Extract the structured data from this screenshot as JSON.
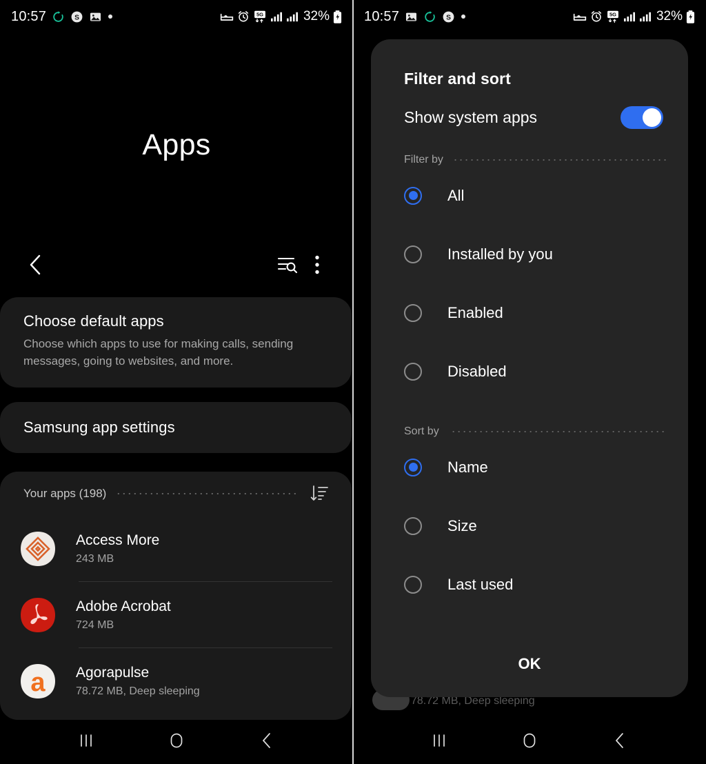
{
  "left": {
    "statusbar": {
      "time": "10:57",
      "battery_percent": "32%",
      "left_icons": [
        "sync-icon",
        "skype-icon",
        "image-icon",
        "dot-icon"
      ],
      "right_icons": [
        "dnd-bed-icon",
        "alarm-icon",
        "5g-icon",
        "signal-sim1-icon",
        "signal-sim2-icon",
        "battery-charging-icon"
      ]
    },
    "title": "Apps",
    "toolbar": {
      "back_icon": "back-chevron-icon",
      "search_icon": "list-search-icon",
      "more_icon": "more-vertical-icon"
    },
    "cards": {
      "default_apps": {
        "title": "Choose default apps",
        "subtitle": "Choose which apps to use for making calls, sending messages, going to websites, and more."
      },
      "samsung_settings": {
        "title": "Samsung app settings"
      }
    },
    "your_apps": {
      "label": "Your apps (198)",
      "sort_icon": "sort-descending-icon",
      "items": [
        {
          "name": "Access More",
          "meta": "243 MB",
          "icon": "access-more-icon"
        },
        {
          "name": "Adobe Acrobat",
          "meta": "724 MB",
          "icon": "adobe-acrobat-icon"
        },
        {
          "name": "Agorapulse",
          "meta": "78.72 MB, Deep sleeping",
          "icon": "agorapulse-icon"
        }
      ]
    }
  },
  "right": {
    "statusbar": {
      "time": "10:57",
      "battery_percent": "32%",
      "left_icons": [
        "image-icon",
        "sync-icon",
        "skype-icon",
        "dot-icon"
      ],
      "right_icons": [
        "dnd-bed-icon",
        "alarm-icon",
        "5g-icon",
        "signal-sim1-icon",
        "signal-sim2-icon",
        "battery-charging-icon"
      ]
    },
    "behind_dialog": {
      "meta": "78.72 MB, Deep sleeping"
    },
    "dialog": {
      "title": "Filter and sort",
      "show_system_apps": {
        "label": "Show system apps",
        "enabled": true
      },
      "filter_by": {
        "label": "Filter by",
        "options": [
          {
            "label": "All",
            "selected": true
          },
          {
            "label": "Installed by you",
            "selected": false
          },
          {
            "label": "Enabled",
            "selected": false
          },
          {
            "label": "Disabled",
            "selected": false
          }
        ]
      },
      "sort_by": {
        "label": "Sort by",
        "options": [
          {
            "label": "Name",
            "selected": true
          },
          {
            "label": "Size",
            "selected": false
          },
          {
            "label": "Last used",
            "selected": false
          }
        ]
      },
      "ok_label": "OK"
    }
  },
  "navbar": {
    "recents_icon": "recents-icon",
    "home_icon": "home-circle-icon",
    "back_icon": "back-chevron-icon"
  },
  "colors": {
    "accent": "#2f6ef0",
    "card_bg": "#1b1b1b",
    "dialog_bg": "#252525",
    "screen_bg": "#000000"
  }
}
